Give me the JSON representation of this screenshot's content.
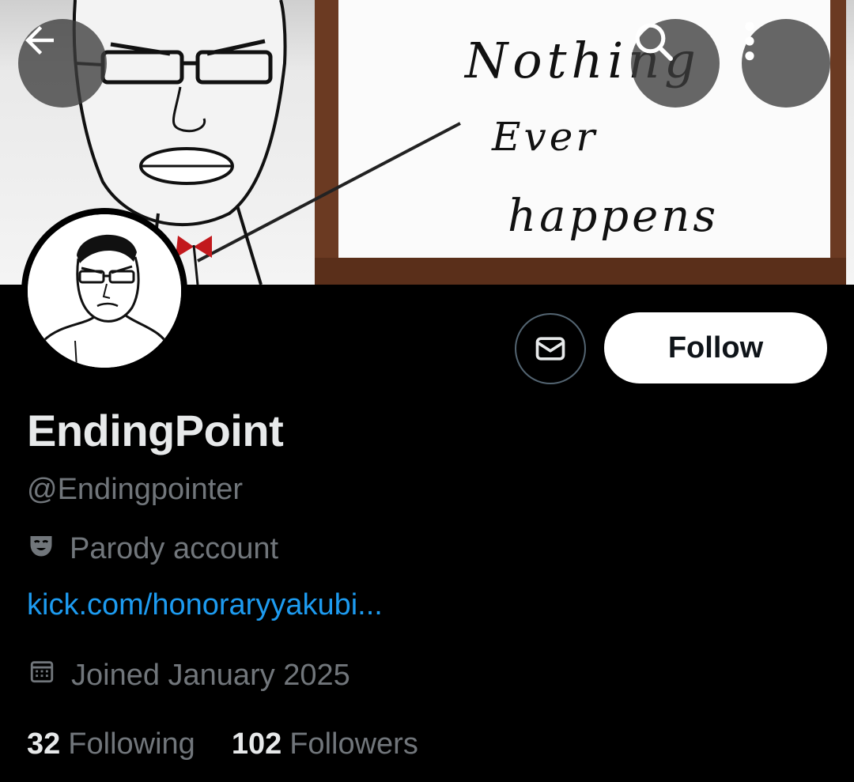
{
  "banner": {
    "text_lines": [
      "Nothing",
      "Ever",
      "happens"
    ]
  },
  "header": {
    "back_icon": "arrow-left-icon",
    "search_icon": "search-icon",
    "more_icon": "more-vertical-icon"
  },
  "actions": {
    "message_icon": "mail-icon",
    "follow_label": "Follow"
  },
  "profile": {
    "display_name": "EndingPoint",
    "handle": "@Endingpointer",
    "parody_label": "Parody account",
    "parody_icon": "theater-mask-icon",
    "website": "kick.com/honoraryyakubi...",
    "joined": "Joined January 2025",
    "joined_icon": "calendar-icon",
    "following_count": "32",
    "following_label": "Following",
    "followers_count": "102",
    "followers_label": "Followers"
  },
  "colors": {
    "background": "#000000",
    "primary_text": "#e7e9ea",
    "secondary_text": "#71767b",
    "link": "#1d9bf0",
    "follow_button_bg": "#ffffff",
    "follow_button_text": "#0f1419"
  }
}
